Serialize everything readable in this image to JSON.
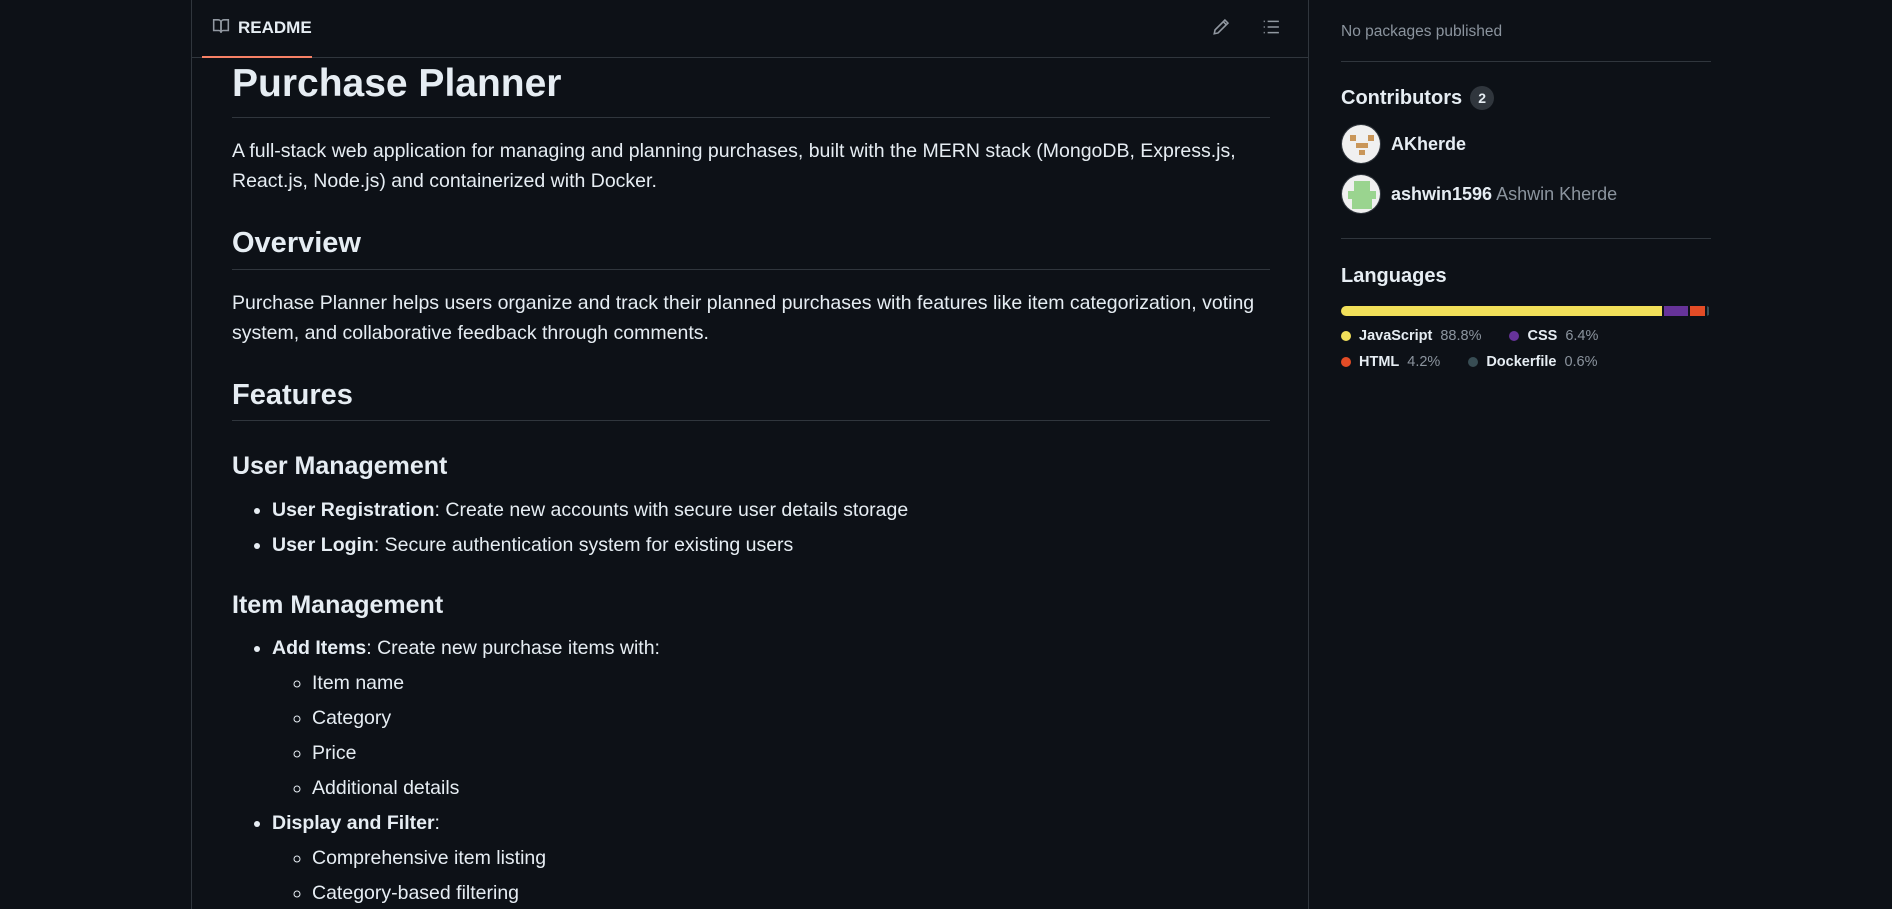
{
  "readme": {
    "tab_label": "README",
    "icons": [
      "book-icon",
      "pencil-icon",
      "list-icon"
    ],
    "title": "Purchase Planner",
    "intro": "A full-stack web application for managing and planning purchases, built with the MERN stack (MongoDB, Express.js, React.js, Node.js) and containerized with Docker.",
    "overview_heading": "Overview",
    "overview_text": "Purchase Planner helps users organize and track their planned purchases with features like item categorization, voting system, and collaborative feedback through comments.",
    "features_heading": "Features",
    "user_mgmt_heading": "User Management",
    "user_mgmt_items": [
      {
        "bold": "User Registration",
        "rest": ": Create new accounts with secure user details storage"
      },
      {
        "bold": "User Login",
        "rest": ": Secure authentication system for existing users"
      }
    ],
    "item_mgmt_heading": "Item Management",
    "add_items": {
      "bold": "Add Items",
      "rest": ": Create new purchase items with:"
    },
    "add_items_sub": [
      "Item name",
      "Category",
      "Price",
      "Additional details"
    ],
    "display_filter": {
      "bold": "Display and Filter",
      "rest": ":"
    },
    "display_filter_sub": [
      "Comprehensive item listing",
      "Category-based filtering"
    ]
  },
  "sidebar": {
    "packages_text": "No packages published",
    "contributors_heading": "Contributors",
    "contributors_count": "2",
    "contributors": [
      {
        "login": "AKherde",
        "name": ""
      },
      {
        "login": "ashwin1596",
        "name": "Ashwin Kherde"
      }
    ],
    "languages_heading": "Languages",
    "languages": [
      {
        "name": "JavaScript",
        "percent": "88.8%",
        "value": 88.8,
        "color": "#f1e05a"
      },
      {
        "name": "CSS",
        "percent": "6.4%",
        "value": 6.4,
        "color": "#663399"
      },
      {
        "name": "HTML",
        "percent": "4.2%",
        "value": 4.2,
        "color": "#e34c26"
      },
      {
        "name": "Dockerfile",
        "percent": "0.6%",
        "value": 0.6,
        "color": "#384d54"
      }
    ]
  }
}
